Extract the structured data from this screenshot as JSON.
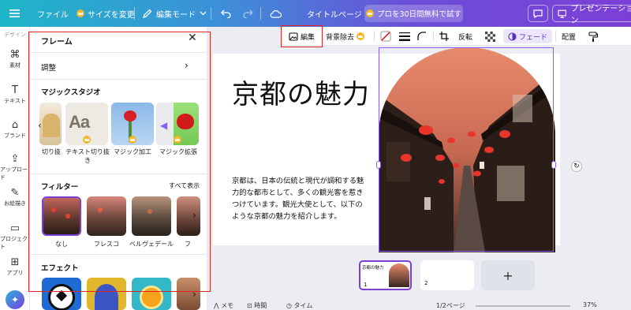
{
  "topbar": {
    "file": "ファイル",
    "resize": "サイズを変更",
    "edit_mode": "編集モード",
    "title": "タイトルページ",
    "trial": "プロを30日間無料で試す",
    "present": "プレゼンテーション"
  },
  "rail": {
    "design": "デザイン",
    "items": [
      "素材",
      "テキスト",
      "ブランド",
      "アップロード",
      "お絵描き",
      "プロジェクト",
      "アプリ"
    ]
  },
  "panel": {
    "title": "フレーム",
    "adjust": "調整",
    "magic_studio": "マジックスタジオ",
    "magic_items": [
      "切り抜",
      "テキスト切り抜き",
      "マジック加工",
      "マジック拡張"
    ],
    "filter": "フィルター",
    "show_all": "すべて表示",
    "filters": [
      "なし",
      "フレスコ",
      "ベルヴェデール",
      "フ"
    ],
    "effects": "エフェクト"
  },
  "ctx": {
    "edit": "編集",
    "bg_remove": "背景除去",
    "flip": "反転",
    "fade": "フェード",
    "arrange": "配置"
  },
  "canvas": {
    "title": "京都の魅力",
    "body": "京都は、日本の伝統と現代が調和する魅力的な都市として、多くの観光客を惹きつけています。観光大使として、以下のような京都の魅力を紹介します。"
  },
  "pages": {
    "thumb1_title": "京都の魅力",
    "p1": "1",
    "p2": "2",
    "add": "+"
  },
  "footer": {
    "memo": "メモ",
    "timer": "時間",
    "duration": "タイム",
    "page_count": "1/2ページ",
    "zoom": "37%"
  }
}
